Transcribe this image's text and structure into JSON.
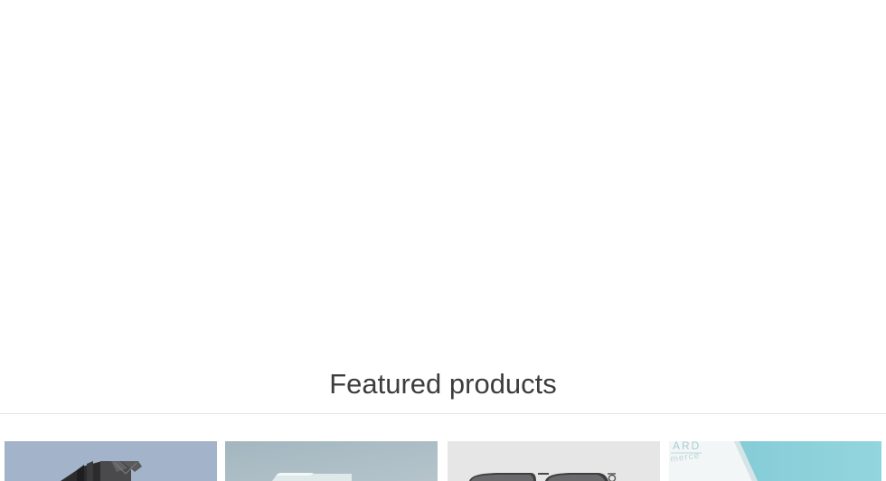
{
  "featured": {
    "title": "Featured products"
  },
  "products": [
    {
      "image_name": "tower-speaker-photo",
      "color": "#a5b6cb"
    },
    {
      "image_name": "white-box-photo",
      "color": "#a8bac3"
    },
    {
      "image_name": "sunglasses-photo",
      "color": "#e5e5e5"
    },
    {
      "image_name": "gift-card-photo",
      "color": "#86cfd9",
      "image_text": "ARD"
    }
  ],
  "colors": {
    "background": "#ffffff",
    "title": "#3d3d3d",
    "divider": "#e4e4e4"
  }
}
